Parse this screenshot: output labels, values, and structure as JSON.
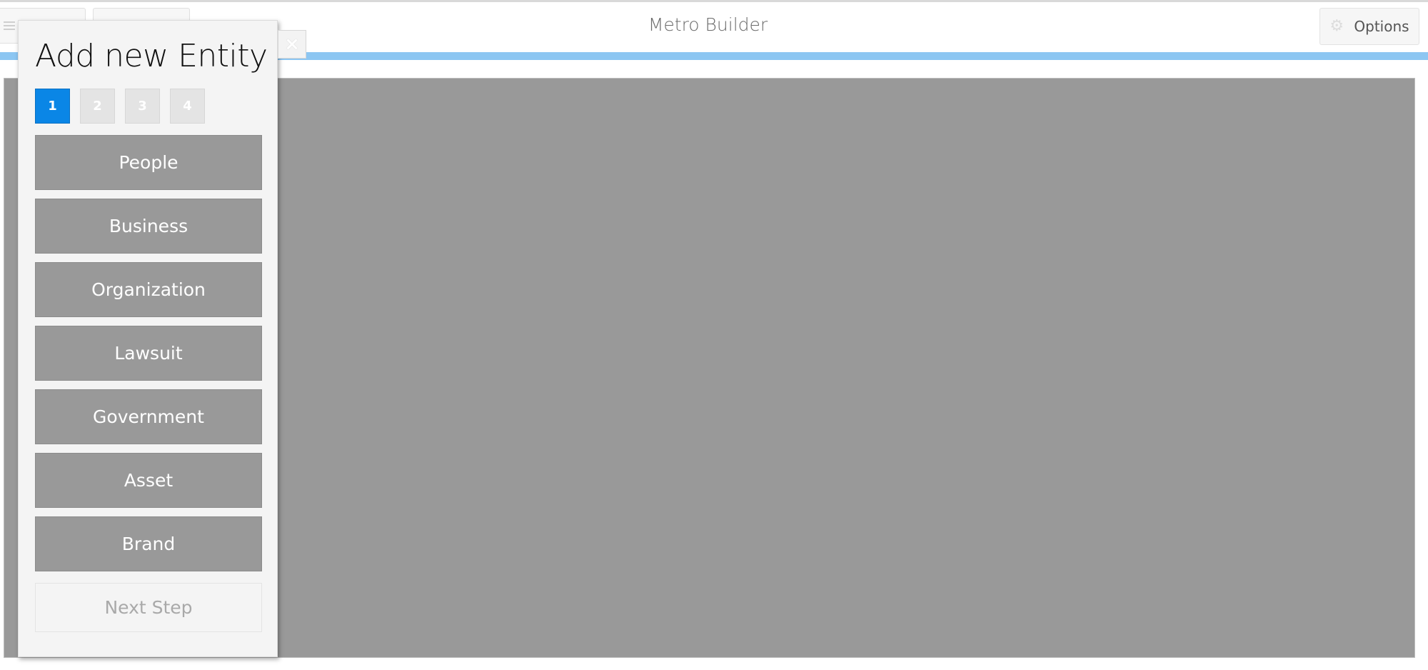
{
  "app": {
    "title": "Metro Builder",
    "options_label": "Options",
    "accent_color": "#8cc6f2"
  },
  "modal": {
    "title": "Add new Entity",
    "close_symbol": "×",
    "steps": [
      {
        "label": "1",
        "active": true
      },
      {
        "label": "2",
        "active": false
      },
      {
        "label": "3",
        "active": false
      },
      {
        "label": "4",
        "active": false
      }
    ],
    "entities": [
      {
        "label": "People"
      },
      {
        "label": "Business"
      },
      {
        "label": "Organization"
      },
      {
        "label": "Lawsuit"
      },
      {
        "label": "Government"
      },
      {
        "label": "Asset"
      },
      {
        "label": "Brand"
      }
    ],
    "next_step_label": "Next Step",
    "active_step_color": "#0a86e6"
  },
  "icons": {
    "menu": "menu-icon",
    "gear": "gear-icon",
    "close": "close-icon"
  }
}
